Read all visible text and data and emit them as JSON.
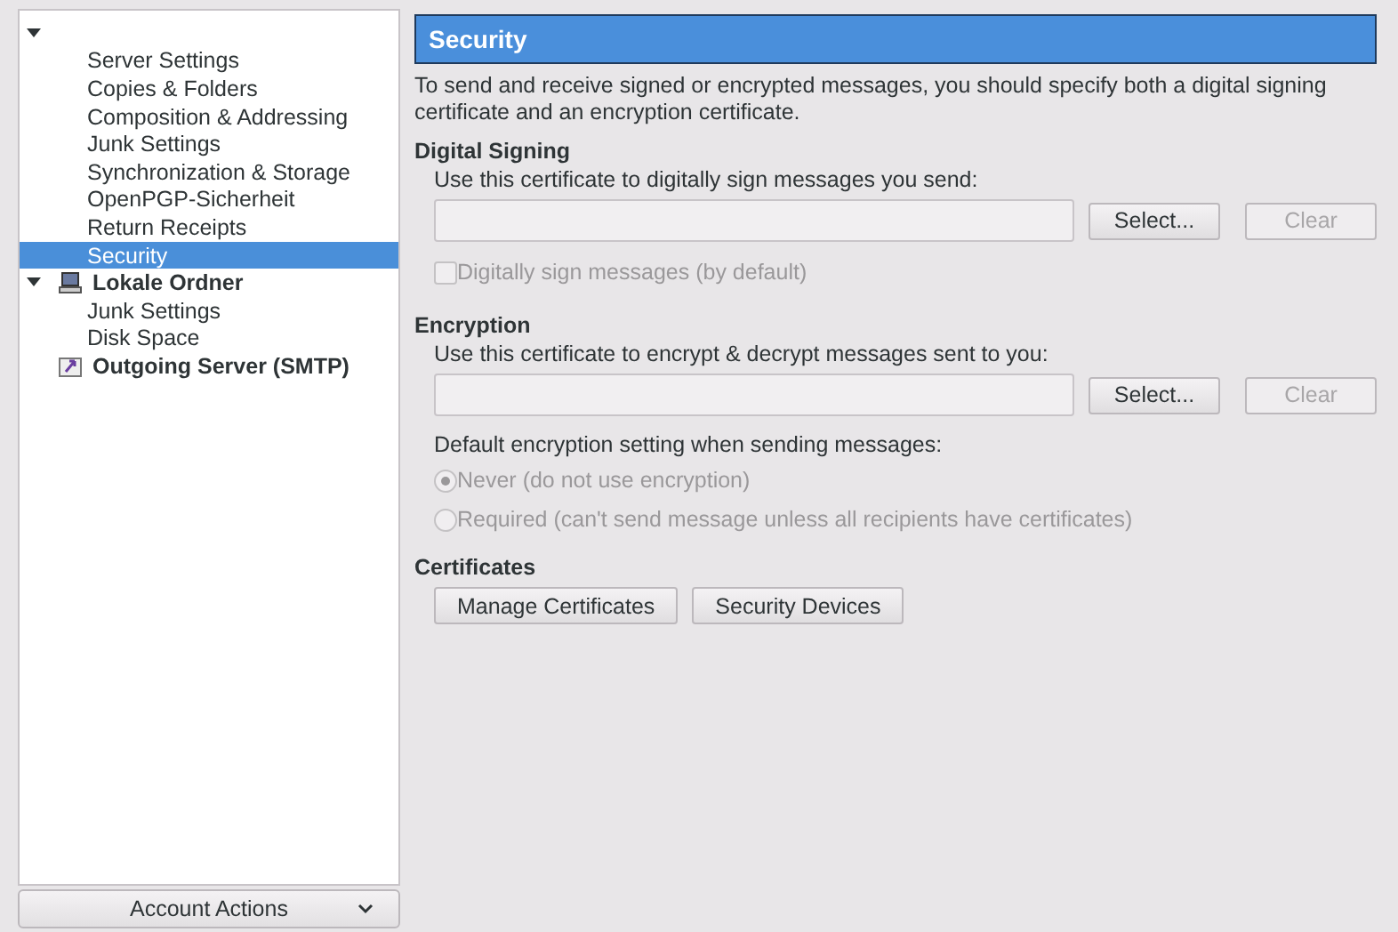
{
  "tree": [
    {
      "kind": "account",
      "expanded": true,
      "children": [
        {
          "label": "Server Settings",
          "selected": false
        },
        {
          "label": "Copies & Folders",
          "selected": false
        },
        {
          "label": "Composition & Addressing",
          "selected": false
        },
        {
          "label": "Junk Settings",
          "selected": false
        },
        {
          "label": "Synchronization & Storage",
          "selected": false
        },
        {
          "label": "OpenPGP-Sicherheit",
          "selected": false
        },
        {
          "label": "Return Receipts",
          "selected": false
        },
        {
          "label": "Security",
          "selected": true
        }
      ]
    },
    {
      "kind": "local",
      "label": "Lokale Ordner",
      "expanded": true,
      "children": [
        {
          "label": "Junk Settings",
          "selected": false
        },
        {
          "label": "Disk Space",
          "selected": false
        }
      ]
    },
    {
      "kind": "smtp",
      "label": "Outgoing Server (SMTP)"
    }
  ],
  "account_actions": {
    "label": "Account Actions"
  },
  "page": {
    "title": "Security",
    "description": "To send and receive signed or encrypted messages, you should specify both a digital signing certificate and an encryption certificate.",
    "signing": {
      "heading": "Digital Signing",
      "prompt": "Use this certificate to digitally sign messages you send:",
      "buttons": [
        {
          "label": "Select...",
          "disabled": false
        },
        {
          "label": "Clear",
          "disabled": true
        }
      ],
      "checkbox": {
        "label": "Digitally sign messages (by default)",
        "checked": false,
        "disabled": true
      }
    },
    "encryption": {
      "heading": "Encryption",
      "prompt": "Use this certificate to encrypt & decrypt messages sent to you:",
      "buttons": [
        {
          "label": "Select...",
          "disabled": false
        },
        {
          "label": "Clear",
          "disabled": true
        }
      ],
      "default_label": "Default encryption setting when sending messages:",
      "options": [
        {
          "label": "Never (do not use encryption)",
          "selected": true,
          "disabled": true
        },
        {
          "label": "Required (can't send message unless all recipients have certificates)",
          "selected": false,
          "disabled": true
        }
      ]
    },
    "certificates": {
      "heading": "Certificates",
      "buttons": [
        "Manage Certificates",
        "Security Devices"
      ]
    }
  }
}
